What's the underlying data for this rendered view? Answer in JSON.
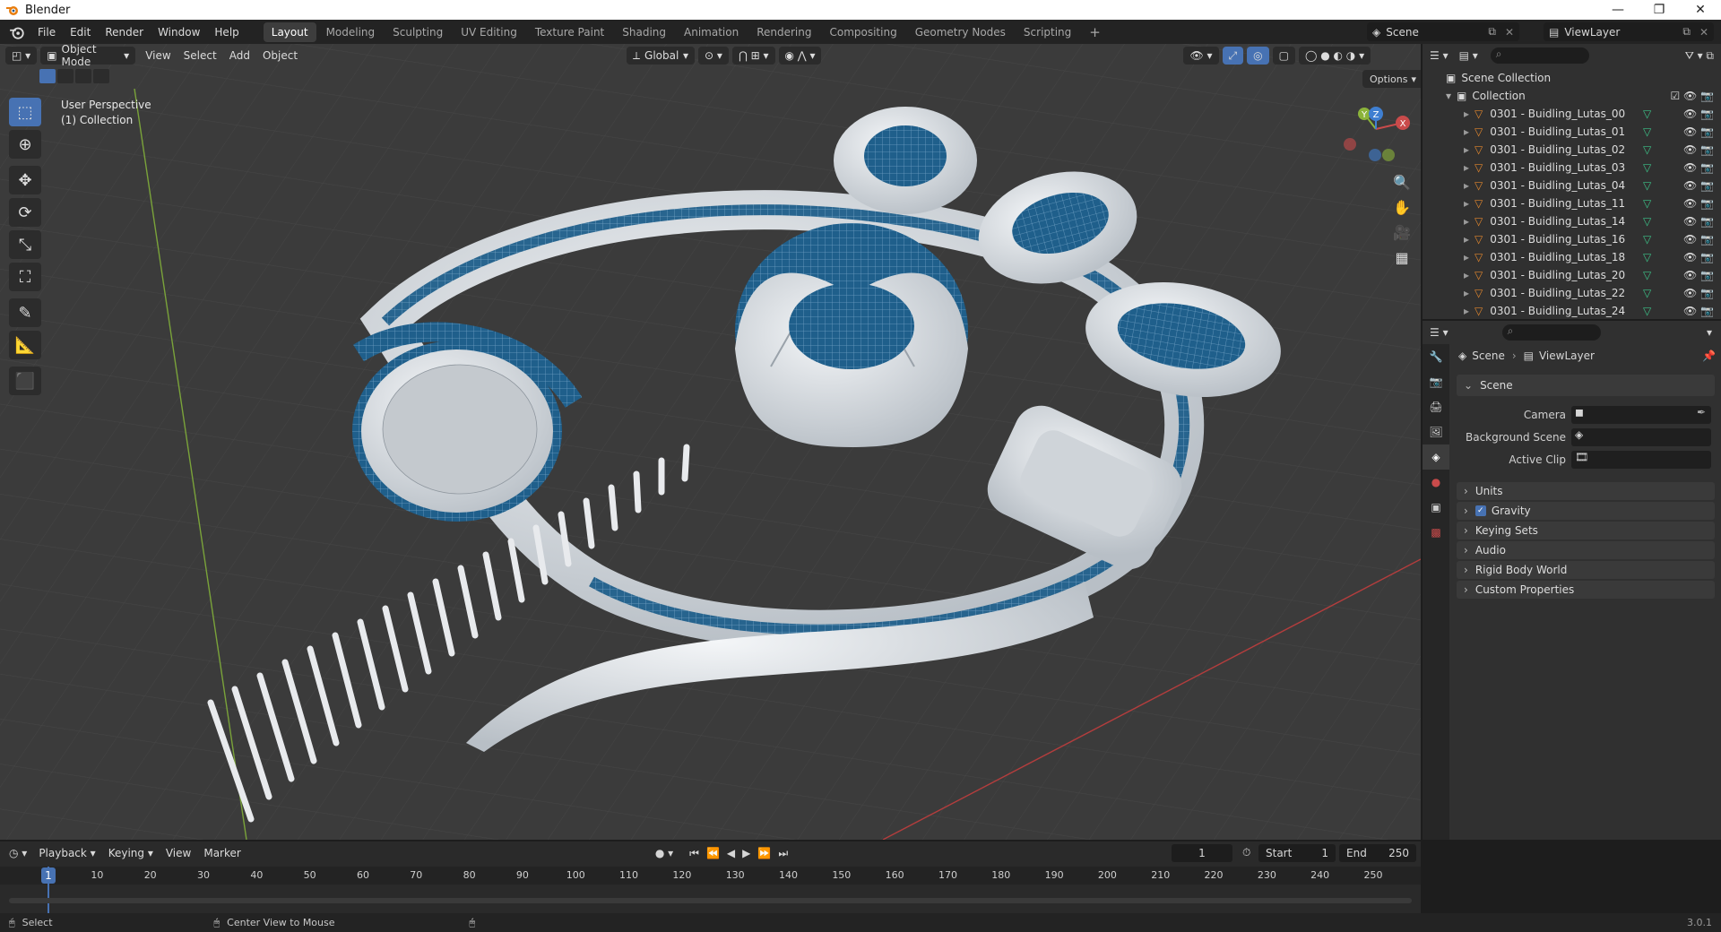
{
  "window": {
    "title": "Blender"
  },
  "menu": [
    "File",
    "Edit",
    "Render",
    "Window",
    "Help"
  ],
  "workspaces": [
    "Layout",
    "Modeling",
    "Sculpting",
    "UV Editing",
    "Texture Paint",
    "Shading",
    "Animation",
    "Rendering",
    "Compositing",
    "Geometry Nodes",
    "Scripting"
  ],
  "scene_selector": {
    "label": "Scene"
  },
  "viewlayer_selector": {
    "label": "ViewLayer"
  },
  "viewport": {
    "mode": "Object Mode",
    "header_menu": [
      "View",
      "Select",
      "Add",
      "Object"
    ],
    "transform_orientation": "Global",
    "options_label": "Options",
    "perspective_label": "User Perspective",
    "collection_label": "(1) Collection",
    "gizmo": {
      "x": "X",
      "y": "Y",
      "z": "Z"
    }
  },
  "outliner": {
    "root": "Scene Collection",
    "collection": "Collection",
    "items": [
      "0301 - Buidling_Lutas_00",
      "0301 - Buidling_Lutas_01",
      "0301 - Buidling_Lutas_02",
      "0301 - Buidling_Lutas_03",
      "0301 - Buidling_Lutas_04",
      "0301 - Buidling_Lutas_11",
      "0301 - Buidling_Lutas_14",
      "0301 - Buidling_Lutas_16",
      "0301 - Buidling_Lutas_18",
      "0301 - Buidling_Lutas_20",
      "0301 - Buidling_Lutas_22",
      "0301 - Buidling_Lutas_24"
    ]
  },
  "properties": {
    "breadcrumb_scene": "Scene",
    "breadcrumb_viewlayer": "ViewLayer",
    "section_scene": "Scene",
    "camera_label": "Camera",
    "background_scene_label": "Background Scene",
    "active_clip_label": "Active Clip",
    "sections": [
      "Units",
      "Gravity",
      "Keying Sets",
      "Audio",
      "Rigid Body World",
      "Custom Properties"
    ],
    "gravity_checked": true
  },
  "timeline": {
    "menu": [
      "Playback",
      "Keying",
      "View",
      "Marker"
    ],
    "current_frame": "1",
    "start_label": "Start",
    "start_value": "1",
    "end_label": "End",
    "end_value": "250",
    "ruler": [
      "1",
      "10",
      "20",
      "30",
      "40",
      "50",
      "60",
      "70",
      "80",
      "90",
      "100",
      "110",
      "120",
      "130",
      "140",
      "150",
      "160",
      "170",
      "180",
      "190",
      "200",
      "210",
      "220",
      "230",
      "240",
      "250"
    ]
  },
  "statusbar": {
    "select_label": "Select",
    "center_view_label": "Center View to Mouse",
    "version": "3.0.1"
  },
  "colors": {
    "accent": "#4772b3",
    "glass_blue": "#1f5f8b",
    "x_axis": "#c94b4b",
    "y_axis": "#8bb33a",
    "z_axis": "#3f7fd1",
    "mesh_icon": "#e0862e",
    "modifier_icon": "#3cc288"
  }
}
